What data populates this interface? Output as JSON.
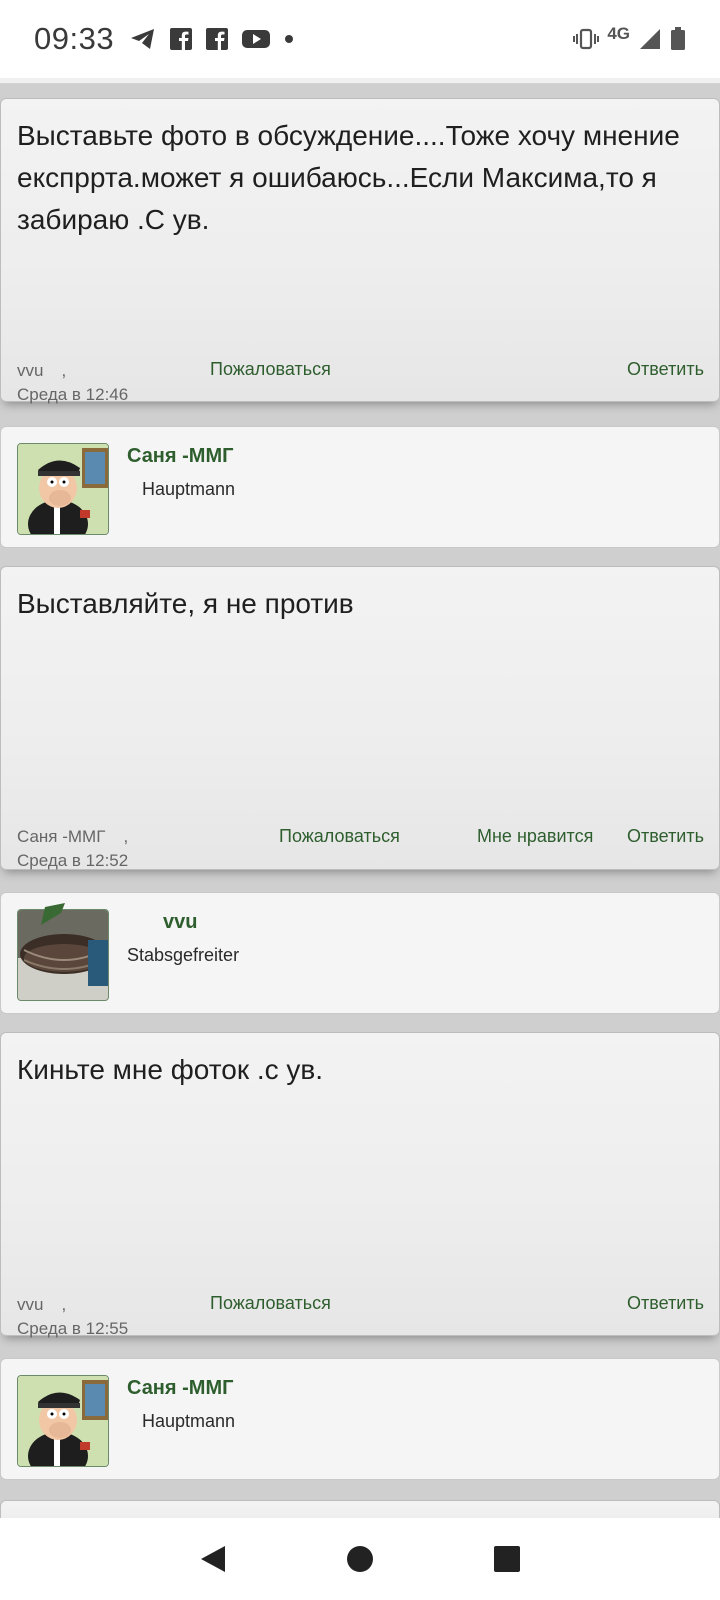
{
  "status_bar": {
    "time": "09:33",
    "network": "4G",
    "left_icons": [
      "telegram-icon",
      "facebook-icon",
      "facebook-icon",
      "youtube-icon",
      "dot-icon"
    ],
    "right_icons": [
      "vibrate-icon",
      "signal-icon",
      "battery-icon"
    ]
  },
  "posts": [
    {
      "text": "Выставьте фото в обсуждение....Тоже хочу мнение експррта.может я ошибаюсь...Если Максима,то я забираю .С ув.",
      "author": "vvu",
      "date": "Среда в 12:46",
      "report": "Пожаловаться",
      "reply": "Ответить"
    },
    {
      "text": "Выставляйте, я не против",
      "author": "Саня -ММГ",
      "date": "Среда в 12:52",
      "report": "Пожаловаться",
      "like": "Мне нравится",
      "reply": "Ответить"
    },
    {
      "text": "Киньте мне фоток .с ув.",
      "author": "vvu",
      "date": "Среда в 12:55",
      "report": "Пожаловаться",
      "reply": "Ответить"
    }
  ],
  "users": [
    {
      "name": "Саня -ММГ",
      "rank": "Hauptmann"
    },
    {
      "name": "vvu",
      "rank": "Stabsgefreiter"
    },
    {
      "name": "Саня -ММГ",
      "rank": "Hauptmann"
    }
  ],
  "comma": ",",
  "colors": {
    "accent_green": "#2e5e2e",
    "page_bg": "#cfcfcf",
    "card_bg": "#f3f3f3"
  },
  "nav": [
    "back-icon",
    "home-icon",
    "recents-icon"
  ]
}
